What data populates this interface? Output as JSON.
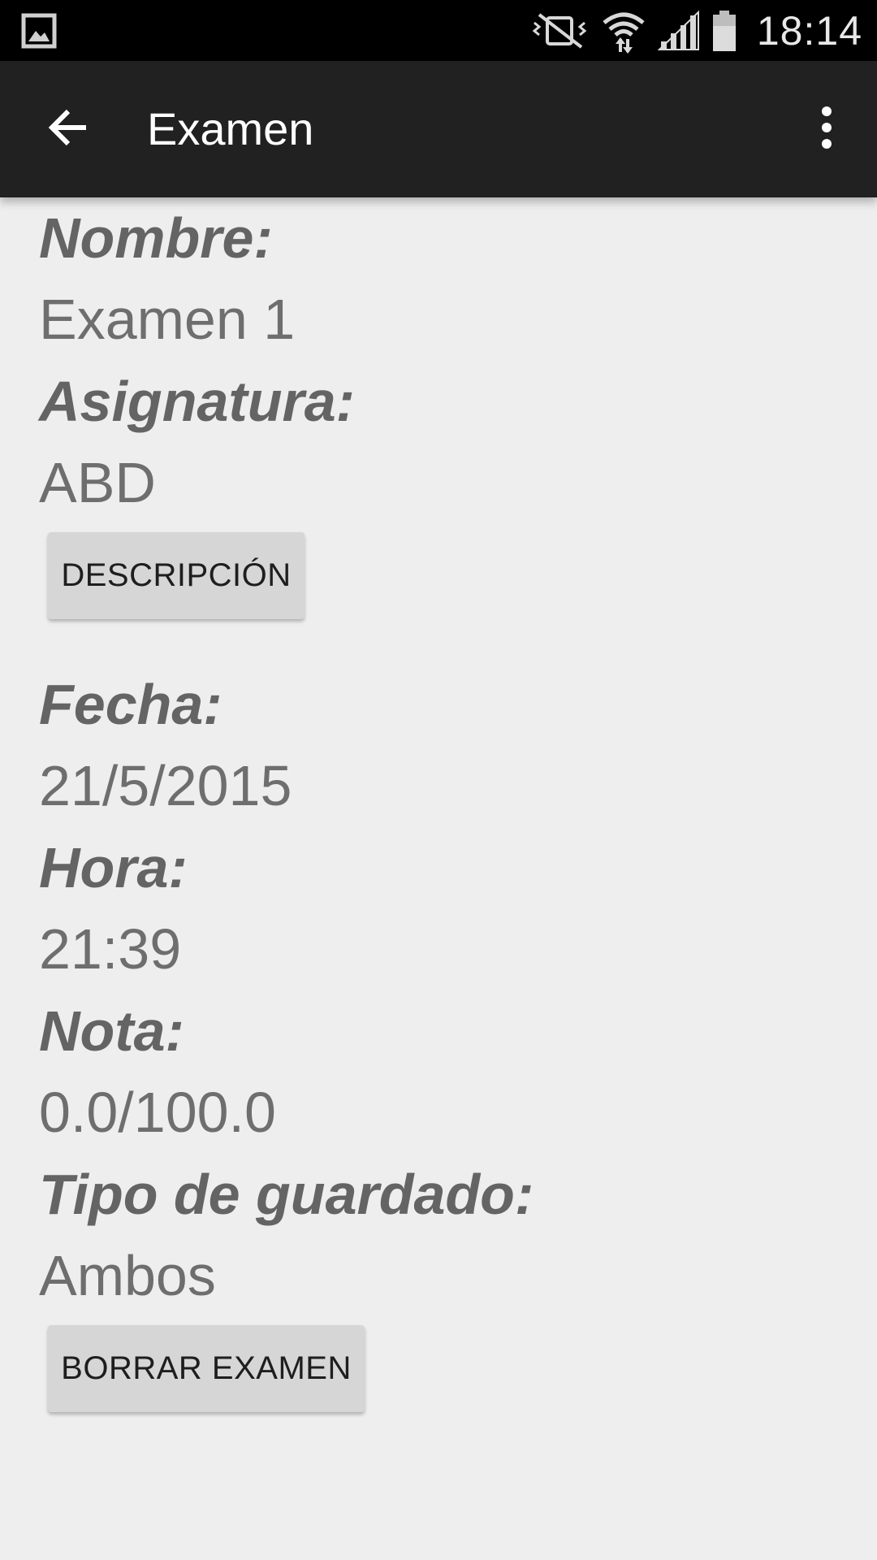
{
  "status_bar": {
    "time": "18:14",
    "icons": [
      "gallery-notification-icon",
      "vibrate-mute-icon",
      "wifi-icon",
      "signal-icon",
      "battery-icon"
    ]
  },
  "app_bar": {
    "title": "Examen",
    "back_icon": "arrow-back-icon",
    "overflow_icon": "more-vert-icon",
    "background": "#212121"
  },
  "exam": {
    "nombre_label": "Nombre:",
    "nombre_value": "Examen 1",
    "asignatura_label": "Asignatura:",
    "asignatura_value": "ABD",
    "descripcion_button": "DESCRIPCIÓN",
    "fecha_label": "Fecha:",
    "fecha_value": "21/5/2015",
    "hora_label": "Hora:",
    "hora_value": "21:39",
    "nota_label": "Nota:",
    "nota_value": "0.0/100.0",
    "tipo_label": "Tipo de guardado:",
    "tipo_value": "Ambos",
    "borrar_button": "BORRAR EXAMEN"
  },
  "colors": {
    "page_background": "#eeeeee",
    "text_gray": "#646464",
    "button_background": "#d6d6d6"
  }
}
